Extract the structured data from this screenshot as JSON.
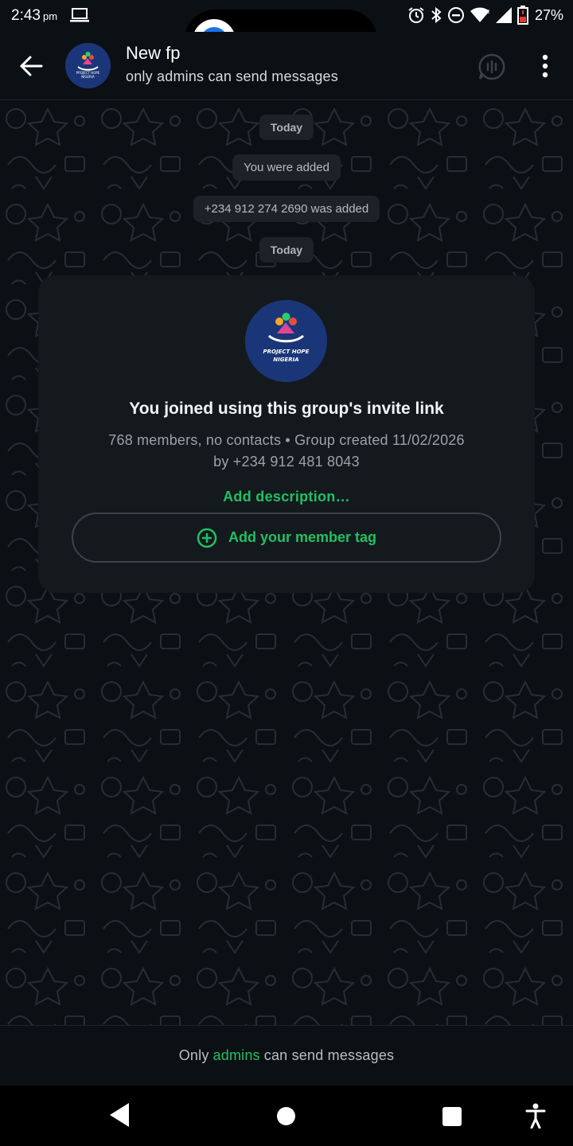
{
  "status_bar": {
    "time": "2:43",
    "ampm": "pm",
    "battery": "27%",
    "icons": [
      "laptop-icon",
      "alarm-icon",
      "bluetooth-icon",
      "dnd-icon",
      "wifi-icon",
      "signal-icon",
      "battery-icon"
    ]
  },
  "header": {
    "title": "New fp",
    "subtitle": "only admins can send messages",
    "avatar_text": [
      "PROJECT HOPE",
      "NIGERIA"
    ]
  },
  "chat": {
    "chips": [
      {
        "type": "date",
        "text": "Today"
      },
      {
        "type": "system",
        "text": "You were added"
      },
      {
        "type": "system",
        "text": "+234 912 274 2690 was added"
      },
      {
        "type": "date",
        "text": "Today"
      }
    ],
    "card": {
      "avatar_text": [
        "PROJECT HOPE",
        "NIGERIA"
      ],
      "title": "You joined using this group's invite link",
      "meta_line1": "768 members, no contacts • Group created 11/02/2026",
      "meta_line2": "by +234 912 481 8043",
      "add_description": "Add description…",
      "member_tag_button": "Add your member tag"
    }
  },
  "footer": {
    "prefix": "Only",
    "highlight": "admins",
    "suffix": "can send messages"
  },
  "colors": {
    "accent_green": "#21c063",
    "background": "#0b1014",
    "card": "#14191d",
    "avatar_blue": "#1b3678"
  }
}
